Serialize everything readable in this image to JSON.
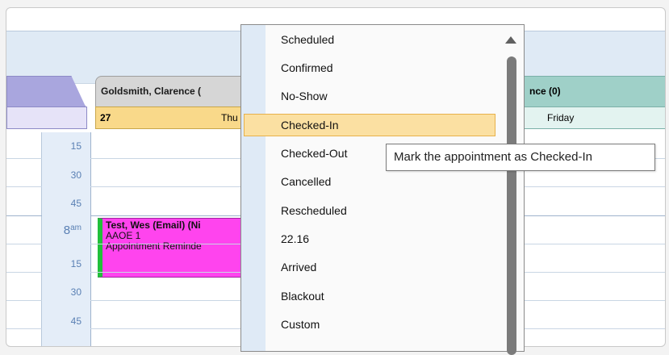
{
  "calendar": {
    "provider_header": "Goldsmith, Clarence (",
    "date_number": "27",
    "weekday": "Thu",
    "right_provider_header": "nce (0)",
    "right_weekday": "Friday"
  },
  "time_labels": [
    {
      "label": "15",
      "hour": false
    },
    {
      "label": "30",
      "hour": false
    },
    {
      "label": "45",
      "hour": false
    },
    {
      "label": "8",
      "suffix": "am",
      "hour": true
    },
    {
      "label": "15",
      "hour": false
    },
    {
      "label": "30",
      "hour": false
    },
    {
      "label": "45",
      "hour": false
    }
  ],
  "appointment": {
    "title": "Test, Wes (Email) (Ni",
    "line2": "AAOE 1",
    "line3": "Appointment Reminde",
    "color": "#ff44ee",
    "status_color": "#22c03a"
  },
  "status_menu": {
    "items": [
      "Scheduled",
      "Confirmed",
      "No-Show",
      "Checked-In",
      "Checked-Out",
      "Cancelled",
      "Rescheduled",
      "22.16",
      "Arrived",
      "Blackout",
      "Custom"
    ],
    "highlighted_index": 3
  },
  "tooltip": {
    "text": "Mark the appointment as Checked-In"
  },
  "colors": {
    "highlight": "#fbe0a2",
    "date_bar": "#f9d98a",
    "right_header": "#9fd0c8"
  }
}
